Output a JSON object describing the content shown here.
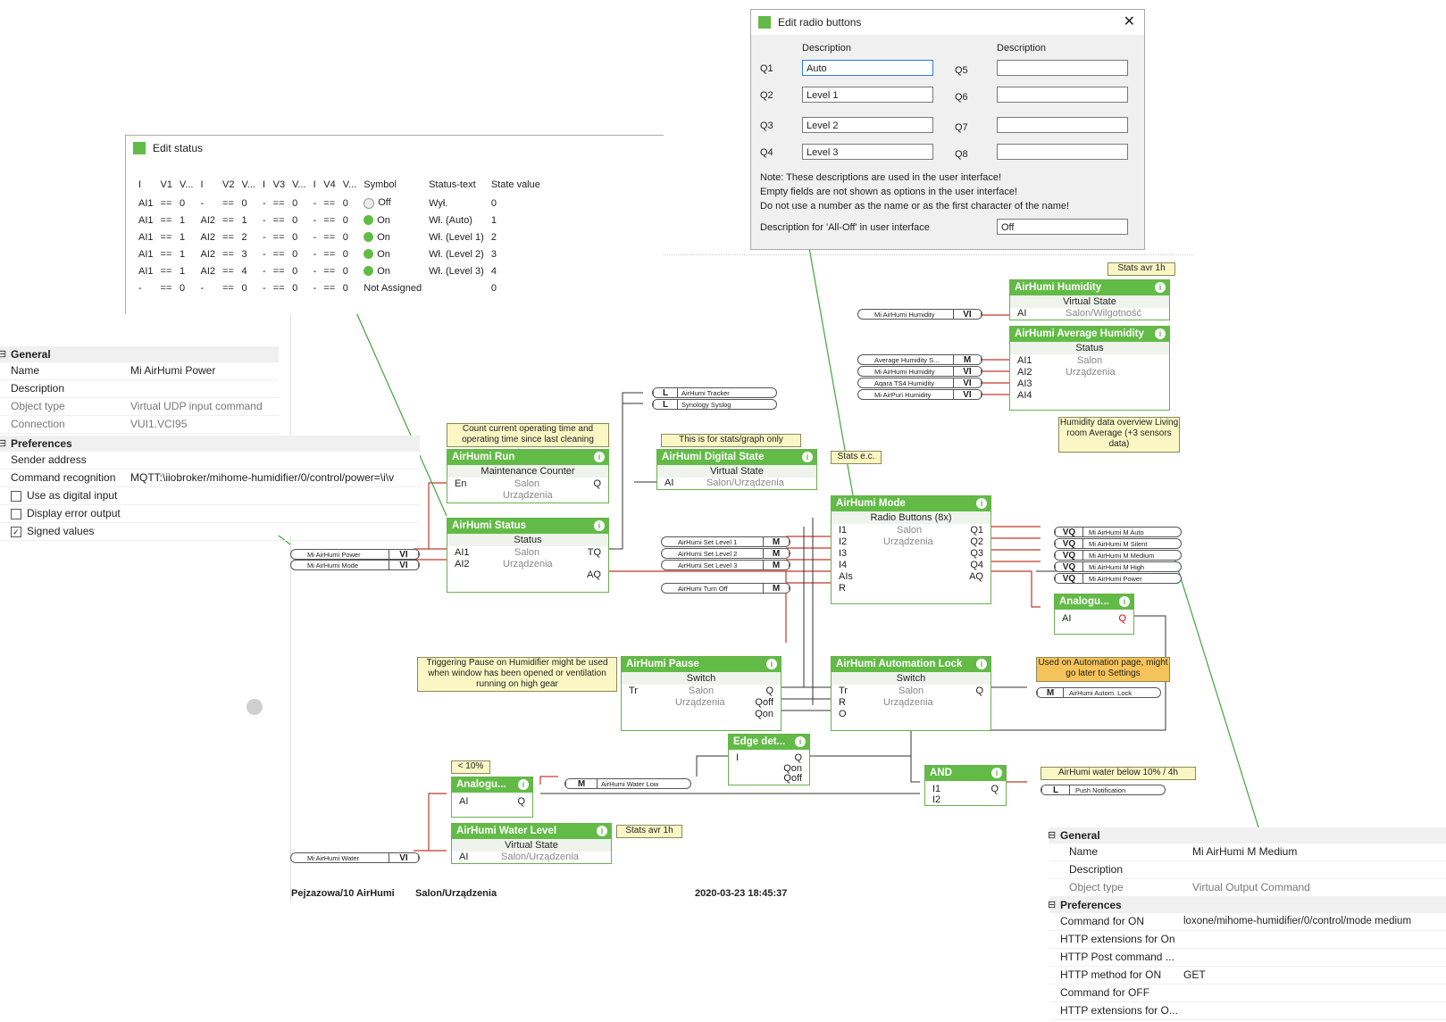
{
  "radio_dialog": {
    "title": "Edit radio buttons",
    "col_header": "Description",
    "left": [
      {
        "q": "Q1",
        "value": "Auto"
      },
      {
        "q": "Q2",
        "value": "Level 1"
      },
      {
        "q": "Q3",
        "value": "Level 2"
      },
      {
        "q": "Q4",
        "value": "Level 3"
      }
    ],
    "right": [
      {
        "q": "Q5",
        "value": ""
      },
      {
        "q": "Q6",
        "value": ""
      },
      {
        "q": "Q7",
        "value": ""
      },
      {
        "q": "Q8",
        "value": ""
      }
    ],
    "note1": "Note: These descriptions are used in the user interface!",
    "note2": "Empty fields are not shown as options in the user interface!",
    "note3": "Do not use a number as the name or as the first character of the name!",
    "alloff_label": "Description for 'All-Off' in user interface",
    "alloff_value": "Off"
  },
  "status_dialog": {
    "title": "Edit status",
    "headers": [
      "I",
      "V1",
      "V...",
      "I",
      "V2",
      "V...",
      "I",
      "V3",
      "V...",
      "I",
      "V4",
      "V...",
      "Symbol",
      "Status-text",
      "State value"
    ],
    "rows": [
      [
        "AI1",
        "==",
        "0",
        "-",
        "==",
        "0",
        "-",
        "==",
        "0",
        "-",
        "==",
        "0",
        "off",
        "Off",
        "Wył.",
        "0"
      ],
      [
        "AI1",
        "==",
        "1",
        "AI2",
        "==",
        "1",
        "-",
        "==",
        "0",
        "-",
        "==",
        "0",
        "on",
        "On",
        "Wł. (Auto)",
        "1"
      ],
      [
        "AI1",
        "==",
        "1",
        "AI2",
        "==",
        "2",
        "-",
        "==",
        "0",
        "-",
        "==",
        "0",
        "on",
        "On",
        "Wł. (Level 1)",
        "2"
      ],
      [
        "AI1",
        "==",
        "1",
        "AI2",
        "==",
        "3",
        "-",
        "==",
        "0",
        "-",
        "==",
        "0",
        "on",
        "On",
        "Wł. (Level 2)",
        "3"
      ],
      [
        "AI1",
        "==",
        "1",
        "AI2",
        "==",
        "4",
        "-",
        "==",
        "0",
        "-",
        "==",
        "0",
        "on",
        "On",
        "Wł. (Level 3)",
        "4"
      ],
      [
        "-",
        "==",
        "0",
        "-",
        "==",
        "0",
        "-",
        "==",
        "0",
        "-",
        "==",
        "0",
        "none",
        "Not Assigned",
        "",
        "0"
      ]
    ]
  },
  "props_left": {
    "general": "General",
    "name_k": "Name",
    "name_v": "Mi AirHumi Power",
    "desc_k": "Description",
    "type_k": "Object type",
    "type_v": "Virtual UDP input command",
    "conn_k": "Connection",
    "conn_v": "VUI1.VCI95",
    "prefs": "Preferences",
    "sender_k": "Sender address",
    "cmd_k": "Command recognition",
    "cmd_v": "MQTT:\\iiobroker/mihome-humidifier/0/control/power=\\i\\v",
    "c1": "Use as digital input",
    "c2": "Display error output",
    "c3": "Signed values"
  },
  "props_right": {
    "general": "General",
    "name_k": "Name",
    "name_v": "Mi AirHumi M Medium",
    "desc_k": "Description",
    "type_k": "Object type",
    "type_v": "Virtual Output Command",
    "prefs": "Preferences",
    "on_k": "Command for ON",
    "on_v": "loxone/mihome-humidifier/0/control/mode medium",
    "ext_k": "HTTP extensions for On",
    "post_k": "HTTP Post command ...",
    "meth_k": "HTTP method for ON",
    "meth_v": "GET",
    "off_k": "Command for OFF",
    "extoff_k": "HTTP extensions for O..."
  },
  "blocks": {
    "run": {
      "title": "AirHumi Run",
      "type": "Maintenance Counter",
      "room": "Salon",
      "cat": "Urządzenia",
      "in": "En",
      "out": "Q"
    },
    "status": {
      "title": "AirHumi Status",
      "type": "Status",
      "room": "Salon",
      "cat": "Urządzenia",
      "in1": "AI1",
      "in2": "AI2",
      "o1": "TQ",
      "o2": "AQ"
    },
    "digital": {
      "title": "AirHumi Digital State",
      "type": "Virtual State",
      "loc": "Salon/Urządzenia",
      "in": "AI"
    },
    "mode": {
      "title": "AirHumi Mode",
      "type": "Radio Buttons (8x)",
      "room": "Salon",
      "cat": "Urządzenia",
      "ins": [
        "I1",
        "I2",
        "I3",
        "I4",
        "AIs",
        "R"
      ],
      "outs": [
        "Q1",
        "Q2",
        "Q3",
        "Q4",
        "AQ"
      ]
    },
    "humidity": {
      "title": "AirHumi Humidity",
      "type": "Virtual State",
      "loc": "Salon/Wilgotność",
      "in": "AI"
    },
    "avg": {
      "title": "AirHumi Average Humidity",
      "type": "Status",
      "room": "Salon",
      "cat": "Urządzenia",
      "ins": [
        "AI1",
        "AI2",
        "AI3",
        "AI4"
      ]
    },
    "analog1": {
      "title": "Analogu...",
      "in": "AI",
      "out": "Q"
    },
    "pause": {
      "title": "AirHumi Pause",
      "type": "Switch",
      "room": "Salon",
      "cat": "Urządzenia",
      "in": "Tr",
      "outs": [
        "Q",
        "Qoff",
        "Qon"
      ]
    },
    "autolock": {
      "title": "AirHumi Automation Lock",
      "type": "Switch",
      "room": "Salon",
      "cat": "Urządzenia",
      "ins": [
        "Tr",
        "R",
        "O"
      ],
      "out": "Q"
    },
    "edge": {
      "title": "Edge det...",
      "in": "I",
      "outs": [
        "Q",
        "Qon",
        "Qoff"
      ]
    },
    "and": {
      "title": "AND",
      "ins": [
        "I1",
        "I2"
      ],
      "out": "Q"
    },
    "analog2": {
      "title": "Analogu...",
      "in": "AI",
      "out": "Q"
    },
    "water": {
      "title": "AirHumi Water Level",
      "type": "Virtual State",
      "loc": "Salon/Urządzenia",
      "in": "AI"
    }
  },
  "pills": {
    "tracker": {
      "tag": "L",
      "text": "AirHumi Tracker"
    },
    "syslog": {
      "tag": "L",
      "text": "Synology Syslog"
    },
    "power": {
      "tag": "VI",
      "text": "Mi AirHumi Power"
    },
    "modein": {
      "tag": "VI",
      "text": "Mi AirHumi Mode"
    },
    "set1": {
      "tag": "M",
      "text": "AirHumi Set Level 1"
    },
    "set2": {
      "tag": "M",
      "text": "AirHumi Set Level 2"
    },
    "set3": {
      "tag": "M",
      "text": "AirHumi Set Level 3"
    },
    "turnoff": {
      "tag": "M",
      "text": "AirHumi Turn Off"
    },
    "hum": {
      "tag": "VI",
      "text": "Mi AirHumi Humidity"
    },
    "avgS": {
      "tag": "M",
      "text": "Average Humidity S..."
    },
    "hum2": {
      "tag": "VI",
      "text": "Mi AirHumi Humidity"
    },
    "aqara": {
      "tag": "VI",
      "text": "Aqara TS4 Humidity"
    },
    "puri": {
      "tag": "VI",
      "text": "Mi AirPuri Humidity"
    },
    "qauto": {
      "tag": "VQ",
      "text": "Mi AirHumi M Auto"
    },
    "qsilent": {
      "tag": "VQ",
      "text": "Mi AirHumi M Silent"
    },
    "qmedium": {
      "tag": "VQ",
      "text": "Mi AirHumi M Medium"
    },
    "qhigh": {
      "tag": "VQ",
      "text": "Mi AirHumi M High"
    },
    "qpower": {
      "tag": "VQ",
      "text": "Mi AirHumi Power"
    },
    "lock": {
      "tag": "M",
      "text": "AirHumi Autom. Lock"
    },
    "waterlow": {
      "tag": "M",
      "text": "AirHumi Water Low"
    },
    "push": {
      "tag": "L",
      "text": "Push Notification"
    },
    "waterin": {
      "tag": "VI",
      "text": "Mi AirHumi Water"
    }
  },
  "notes": {
    "count": "Count current operating time and operating time since last cleaning",
    "stats": "This is for stats/graph only",
    "statsec": "Stats e.c.",
    "statsavr": "Stats avr 1h",
    "overview": "Humidity data overview Living room Average (+3 sensors data)",
    "pause": "Triggering Pause on Humidifier might be used when window has been opened or ventilation running on high gear",
    "autopage": "Used on Automation page, might go later to Settings",
    "lt10": "< 10%",
    "below": "AirHumi water below 10% / 4h",
    "statsavr2": "Stats avr 1h"
  },
  "footer": {
    "page": "Pejzazowa/10 AirHumi",
    "room": "Salon/Urządzenia",
    "date": "2020-03-23 18:45:37"
  }
}
